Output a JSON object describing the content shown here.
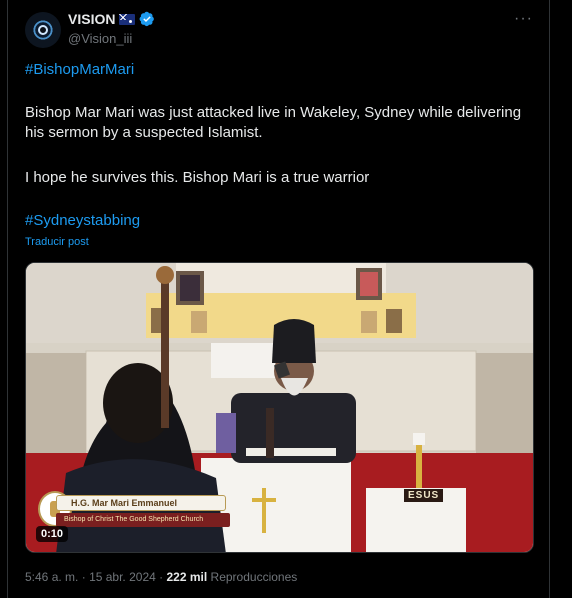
{
  "author": {
    "display_name": "VISION",
    "flag_icon": "australia-flag-icon",
    "verified_icon": "verified-badge-icon",
    "handle": "@Vision_iii"
  },
  "more_icon": "more-options-icon",
  "tweet": {
    "hashtag_top": "#BishopMarMari",
    "paragraph_1": "Bishop Mar Mari was just attacked live in Wakeley, Sydney while delivering his sermon by a suspected Islamist.",
    "paragraph_2": "I hope he survives this. Bishop Mari is a true warrior",
    "hashtag_bottom": "#Sydneystabbing",
    "translate_label": "Traducir post"
  },
  "media": {
    "duration": "0:10",
    "lower_third_name": "H.G. Mar Mari Emmanuel",
    "lower_third_sub": "Bishop of Christ The Good Shepherd Church",
    "altar_text": "ESUS"
  },
  "meta": {
    "time": "5:46 a. m.",
    "separator": "·",
    "date": "15 abr. 2024",
    "views_count": "222 mil",
    "views_label": "Reproducciones"
  },
  "colors": {
    "link": "#1d9bf0",
    "text": "#e7e9ea",
    "muted": "#71767b",
    "background": "#000000"
  }
}
